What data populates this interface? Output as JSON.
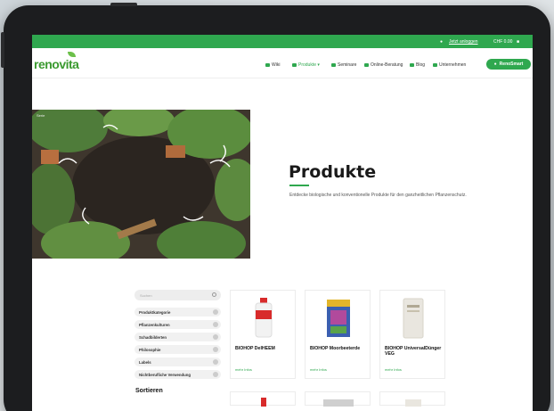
{
  "topbar": {
    "login": "Jetzt anloggen",
    "cart": "CHF 0.00"
  },
  "brand": {
    "logo": "renovita"
  },
  "nav": {
    "items": [
      "Wiki",
      "Produkte",
      "Seminare",
      "Online-Beratung",
      "Blog",
      "Unternehmen"
    ],
    "cta": "RenoSmart"
  },
  "hero": {
    "image_label": "Serie",
    "title": "Produkte",
    "subtitle": "Entdecke biologische und konventionelle Produkte für den ganzheitlichen Pflanzenschutz."
  },
  "sidebar": {
    "search_placeholder": "Suchen",
    "filters": [
      "Produktkategorie",
      "Pflanzenkulturen",
      "Schadbilderten",
      "Philosophie",
      "Labels",
      "Nichtberufliche Verwendung"
    ],
    "sort_title": "Sortieren"
  },
  "products": [
    {
      "name": "BIOHOP DelHEEM",
      "more": "mehr Infos"
    },
    {
      "name": "BIOHOP Moorbeeterde",
      "more": "mehr Infos"
    },
    {
      "name": "BIOHOP UniversalDünger VEG",
      "more": "mehr Infos"
    }
  ],
  "colors": {
    "brand_green": "#2fa84f",
    "hero_bg": "#4c4338"
  }
}
